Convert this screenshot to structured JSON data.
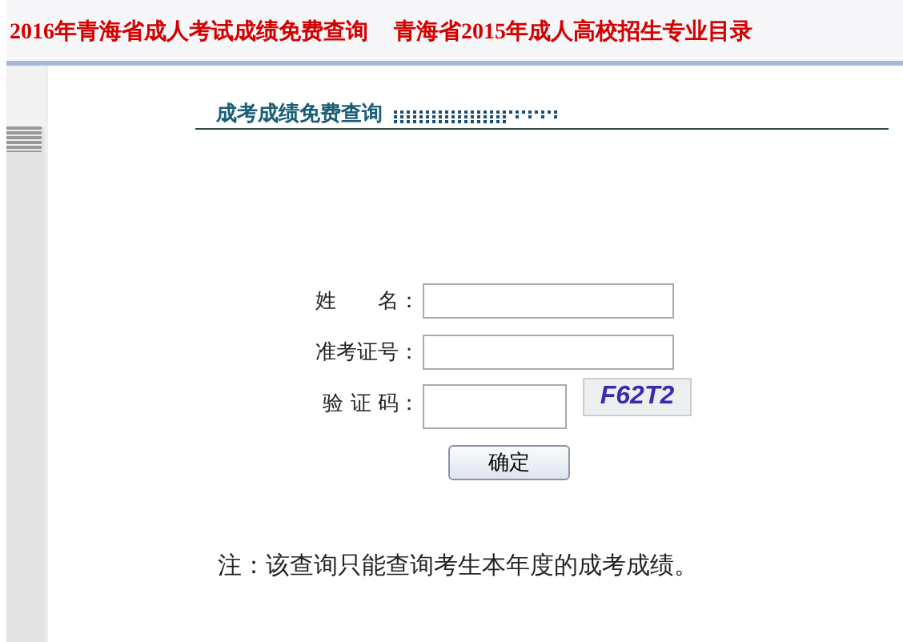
{
  "top_links": [
    "2016年青海省成人考试成绩免费查询",
    "青海省2015年成人高校招生专业目录"
  ],
  "heading": "成考成绩免费查询",
  "form": {
    "fields": [
      {
        "label": "姓　　名：",
        "kind": "text"
      },
      {
        "label": "准考证号：",
        "kind": "text"
      },
      {
        "label": "验 证 码：",
        "kind": "captcha"
      }
    ],
    "captcha_text": "F62T2",
    "submit": "确定"
  },
  "note": "注：该查询只能查询考生本年度的成考成绩。"
}
